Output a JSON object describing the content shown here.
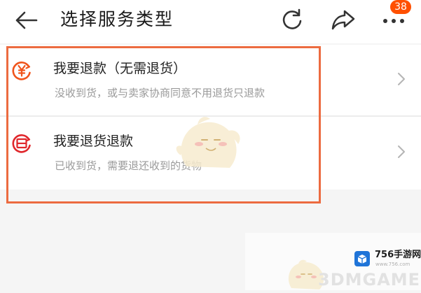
{
  "header": {
    "title": "选择服务类型",
    "badge_count": "38"
  },
  "options": [
    {
      "title": "我要退款（无需退货）",
      "description": "没收到货，或与卖家协商同意不用退货只退款",
      "icon": "yuan-refund-icon"
    },
    {
      "title": "我要退货退款",
      "description": "已收到货，需要退还收到的货物",
      "icon": "return-goods-icon"
    }
  ],
  "colors": {
    "accent": "#ff5000",
    "highlight_border": "#ec6b40",
    "refund_icon": "#f0541b",
    "return_icon": "#e0262b"
  },
  "watermark": {
    "logo_text": "756手游网",
    "logo_url": "www.756.com",
    "overlay_text": "3DMGAME"
  }
}
